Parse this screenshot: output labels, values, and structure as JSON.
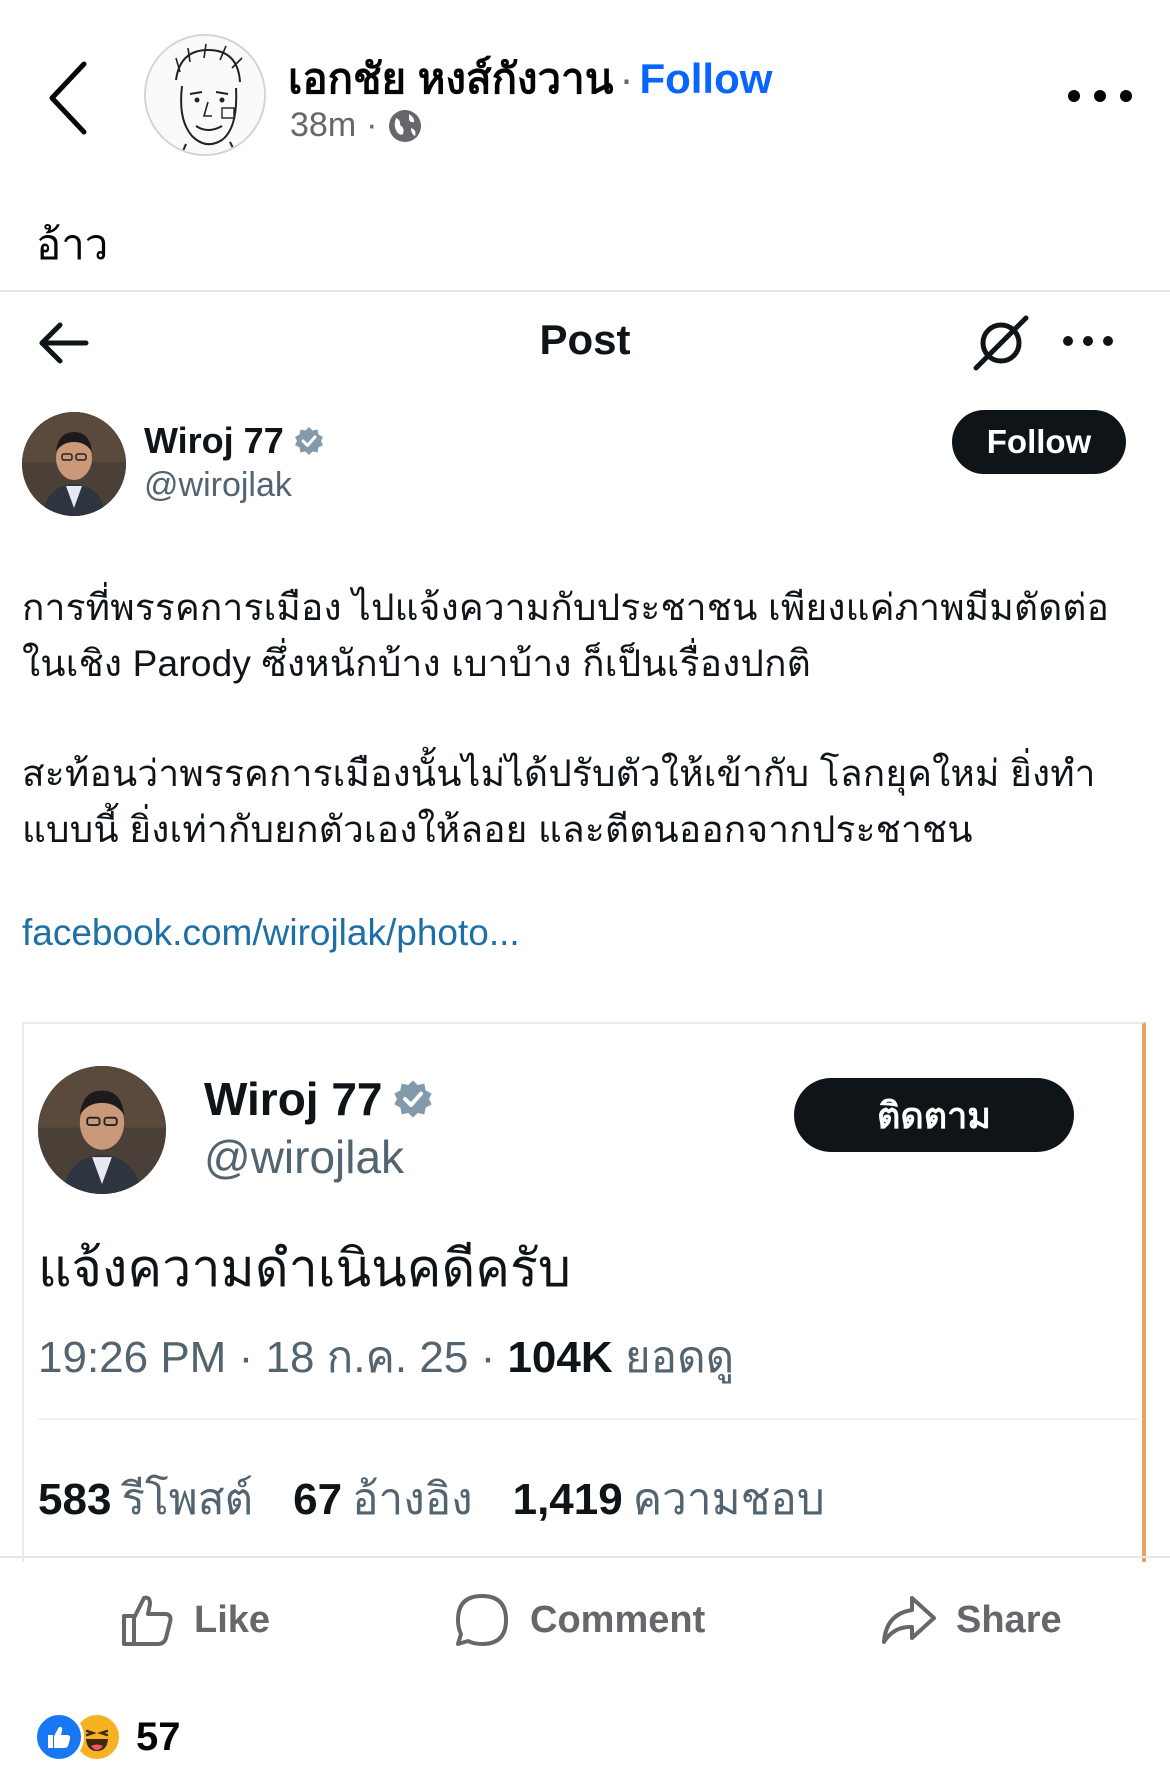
{
  "fb_post": {
    "author": "เอกชัย หงส์กังวาน",
    "separator": "·",
    "follow_label": "Follow",
    "time": "38m",
    "meta_separator": "·",
    "caption": "อ้าว"
  },
  "x_post": {
    "header_title": "Post",
    "author_name": "Wiroj 77",
    "handle": "@wirojlak",
    "follow_label": "Follow",
    "paragraph_1_line_1": "การที่พรรคการเมือง ไปแจ้งความกับประชาชน เพียงแค่ภาพมีมตัดต่อ",
    "paragraph_1_line_2": "ในเชิง Parody ซึ่งหนักบ้าง เบาบ้าง ก็เป็นเรื่องปกติ",
    "paragraph_2_line_1": "สะท้อนว่าพรรคการเมืองนั้นไม่ได้ปรับตัวให้เข้ากับ โลกยุคใหม่ ยิ่งทำ",
    "paragraph_2_line_2": "แบบนี้ ยิ่งเท่ากับยกตัวเองให้ลอย และตีตนออกจากประชาชน",
    "link": "facebook.com/wirojlak/photo..."
  },
  "quoted": {
    "author_name": "Wiroj 77",
    "handle": "@wirojlak",
    "follow_label": "ติดตาม",
    "text": "แจ้งความดำเนินคดีครับ",
    "time": "19:26 PM",
    "date": "18 ก.ค. 25",
    "meta_separator": "·",
    "views_count": "104K",
    "views_label": "ยอดดู",
    "reposts_count": "583",
    "reposts_label": "รีโพสต์",
    "quotes_count": "67",
    "quotes_label": "อ้างอิง",
    "likes_count": "1,419",
    "likes_label": "ความชอบ"
  },
  "actions": {
    "like_label": "Like",
    "comment_label": "Comment",
    "share_label": "Share"
  },
  "reactions": {
    "count": "57",
    "types": [
      "like",
      "haha"
    ]
  },
  "colors": {
    "fb_blue": "#0866ff",
    "x_black": "#0f1419",
    "x_gray": "#536471",
    "link_blue": "#1d6fa5",
    "verified_badge": "#829aab",
    "quote_border_accent": "#e8a45c"
  },
  "icons": [
    "back-chevron-icon",
    "globe-icon",
    "more-options-icon",
    "back-arrow-icon",
    "grok-icon",
    "verified-badge-icon",
    "like-icon",
    "comment-icon",
    "share-icon",
    "like-reaction-icon",
    "haha-reaction-icon"
  ]
}
